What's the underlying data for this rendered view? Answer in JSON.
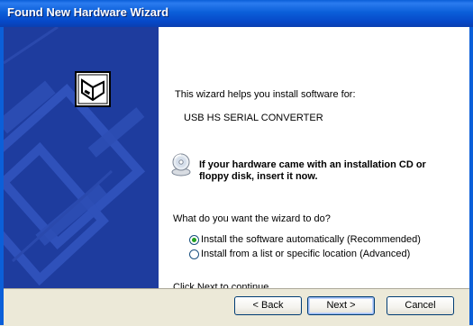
{
  "window": {
    "title": "Found New Hardware Wizard"
  },
  "intro": {
    "heading": "This wizard helps you install software for:",
    "device": "USB HS SERIAL CONVERTER"
  },
  "cd_hint": {
    "line1": "If your hardware came with an installation CD or",
    "line2": "floppy disk, insert it now."
  },
  "question": "What do you want the wizard to do?",
  "options": [
    {
      "label": "Install the software automatically (Recommended)",
      "selected": true
    },
    {
      "label": "Install from a list or specific location (Advanced)",
      "selected": false
    }
  ],
  "footer_text": "Click Next to continue.",
  "buttons": {
    "back": "< Back",
    "next": "Next >",
    "cancel": "Cancel"
  },
  "colors": {
    "title_bar": "#0B5FD9",
    "side_panel": "#1E3C9E",
    "radio_dot": "#21A121"
  }
}
